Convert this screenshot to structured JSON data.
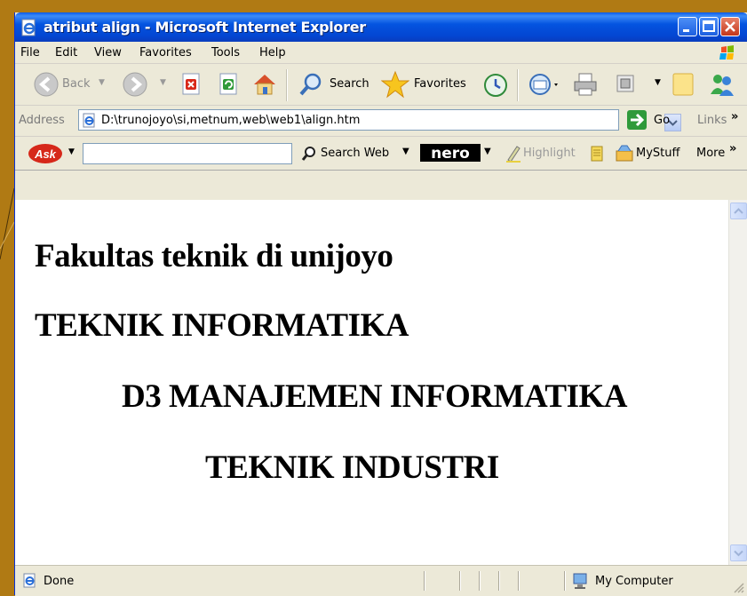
{
  "window": {
    "title": "atribut align - Microsoft Internet Explorer"
  },
  "menu": {
    "items": [
      "File",
      "Edit",
      "View",
      "Favorites",
      "Tools",
      "Help"
    ]
  },
  "toolbar": {
    "back_label": "Back",
    "search_label": "Search",
    "favorites_label": "Favorites"
  },
  "address_bar": {
    "label": "Address",
    "value": "D:\\trunojoyo\\si,metnum,web\\web1\\align.htm",
    "go_label": "Go",
    "links_label": "Links",
    "links_chevron": "»"
  },
  "ask_toolbar": {
    "search_value": "",
    "search_web_label": "Search Web",
    "highlight_label": "Highlight",
    "mystuff_label": "MyStuff",
    "more_label": "More"
  },
  "page": {
    "headings": [
      "Fakultas teknik di unijoyo",
      "TEKNIK INFORMATIKA",
      "D3 MANAJEMEN INFORMATIKA",
      "TEKNIK INDUSTRI"
    ]
  },
  "status_bar": {
    "text": "Done",
    "zone": "My Computer"
  },
  "colors": {
    "slide_background": "#b07a14",
    "title_bar": "#0454e0",
    "chrome": "#ece9d8"
  },
  "icons": [
    "ie-page-icon",
    "windows-logo-icon",
    "back-icon",
    "forward-icon",
    "stop-icon",
    "refresh-icon",
    "home-icon",
    "search-icon",
    "favorites-star-icon",
    "history-icon",
    "mail-icon",
    "print-icon",
    "edit-icon",
    "discuss-icon",
    "messenger-icon",
    "go-arrow-icon",
    "ask-logo",
    "nero-logo",
    "highlight-icon",
    "mystuff-icon",
    "globe-icon",
    "computer-icon"
  ]
}
